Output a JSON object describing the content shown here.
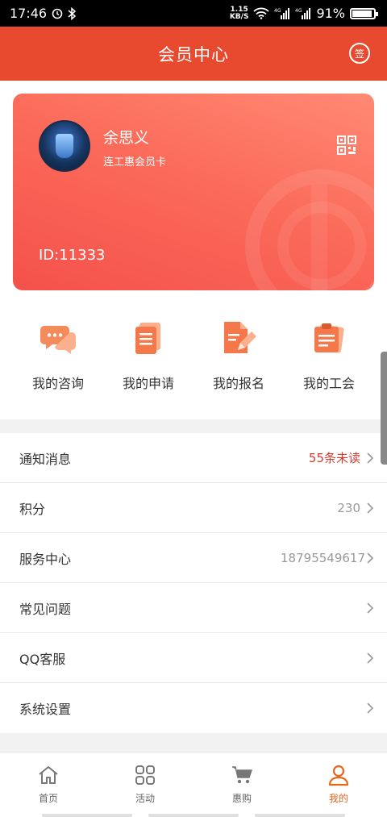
{
  "status_bar": {
    "time": "17:46",
    "speed_value": "1.15",
    "speed_unit": "KB/S",
    "battery": "91%",
    "battery_level": 0.91
  },
  "header": {
    "title": "会员中心",
    "sign_label": "签"
  },
  "card": {
    "user_name": "余思义",
    "card_type": "连工惠会员卡",
    "id_text": "ID:11333"
  },
  "quick_actions": [
    {
      "label": "我的咨询",
      "icon": "chat-bubbles-icon"
    },
    {
      "label": "我的申请",
      "icon": "document-stack-icon"
    },
    {
      "label": "我的报名",
      "icon": "document-pen-icon"
    },
    {
      "label": "我的工会",
      "icon": "clipboard-pin-icon"
    }
  ],
  "menu": [
    {
      "label": "通知消息",
      "value": "55条未读"
    },
    {
      "label": "积分",
      "value": "230"
    },
    {
      "label": "服务中心",
      "value": "18795549617"
    },
    {
      "label": "常见问题",
      "value": ""
    },
    {
      "label": "QQ客服",
      "value": ""
    },
    {
      "label": "系统设置",
      "value": ""
    }
  ],
  "tabs": [
    {
      "label": "首页",
      "icon": "home-icon"
    },
    {
      "label": "活动",
      "icon": "grid-icon"
    },
    {
      "label": "惠购",
      "icon": "cart-icon"
    },
    {
      "label": "我的",
      "icon": "user-icon",
      "active": true
    }
  ],
  "colors": {
    "header": "#e84a2f",
    "accent_tab": "#e8661e",
    "unread": "#d83a2e",
    "card_gradient_start": "#ff8a74",
    "card_gradient_end": "#f4514b"
  }
}
